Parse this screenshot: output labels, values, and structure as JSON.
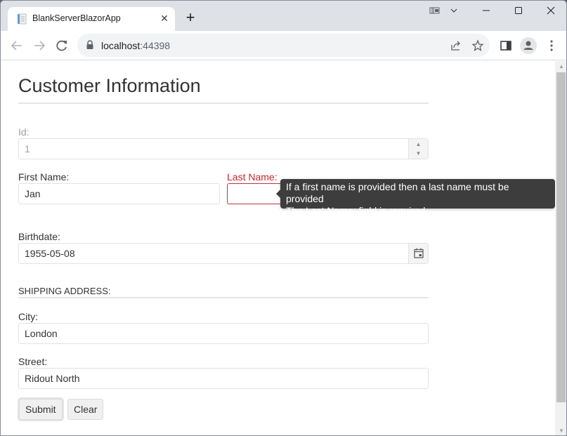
{
  "browser": {
    "tab_title": "BlankServerBlazorApp",
    "tab_favicon": "document-icon",
    "url_host": "localhost",
    "url_port": ":44398",
    "icons": {
      "back": "arrow-left-icon",
      "forward": "arrow-right-icon",
      "reload": "reload-icon",
      "lock": "lock-icon",
      "share": "share-icon",
      "bookmark": "star-icon",
      "side_panel": "side-panel-icon",
      "profile": "profile-icon",
      "menu": "kebab-menu-icon",
      "cast": "cast-icon",
      "tab_search": "chevron-down-icon",
      "minimize": "minimize-icon",
      "maximize": "maximize-icon",
      "close": "close-icon"
    }
  },
  "form": {
    "title": "Customer Information",
    "id": {
      "label": "Id:",
      "value": "1",
      "disabled": true
    },
    "first_name": {
      "label": "First Name:",
      "value": "Jan"
    },
    "last_name": {
      "label": "Last Name:",
      "value": "",
      "invalid": true
    },
    "validation_tooltip": {
      "lines": [
        "If a first name is provided then a last name must be provided",
        "The Last Name: field is required."
      ]
    },
    "birthdate": {
      "label": "Birthdate:",
      "value": "1955-05-08"
    },
    "shipping_section": "SHIPPING ADDRESS:",
    "city": {
      "label": "City:",
      "value": "London"
    },
    "street": {
      "label": "Street:",
      "value": "Ridout North"
    },
    "buttons": {
      "submit": "Submit",
      "clear": "Clear"
    }
  },
  "colors": {
    "error": "#c4262e",
    "tooltip_bg": "#3d3d3d",
    "tab_strip": "#dee1e6"
  }
}
